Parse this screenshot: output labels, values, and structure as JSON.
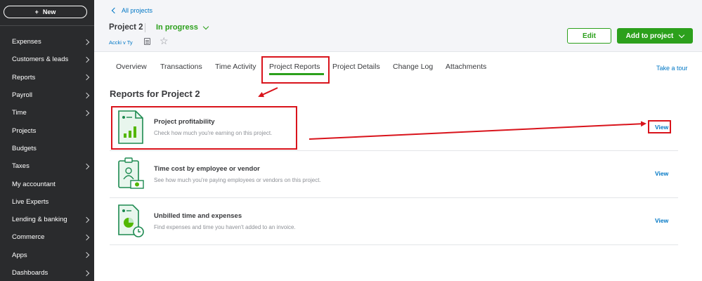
{
  "sidebar": {
    "new_label": "New",
    "items": [
      {
        "label": "Expenses",
        "chevron": true
      },
      {
        "label": "Customers & leads",
        "chevron": true
      },
      {
        "label": "Reports",
        "chevron": true
      },
      {
        "label": "Payroll",
        "chevron": true
      },
      {
        "label": "Time",
        "chevron": true
      },
      {
        "label": "Projects",
        "chevron": false
      },
      {
        "label": "Budgets",
        "chevron": false
      },
      {
        "label": "Taxes",
        "chevron": true
      },
      {
        "label": "My accountant",
        "chevron": false
      },
      {
        "label": "Live Experts",
        "chevron": false
      },
      {
        "label": "Lending & banking",
        "chevron": true
      },
      {
        "label": "Commerce",
        "chevron": true
      },
      {
        "label": "Apps",
        "chevron": true
      },
      {
        "label": "Dashboards",
        "chevron": true
      }
    ]
  },
  "header": {
    "back_label": "All projects",
    "project_name": "Project 2",
    "status": "In progress",
    "customer": "Accki v Ty",
    "edit_label": "Edit",
    "add_label": "Add to project"
  },
  "tabs": {
    "items": [
      "Overview",
      "Transactions",
      "Time Activity",
      "Project Reports",
      "Project Details",
      "Change Log",
      "Attachments"
    ],
    "active": "Project Reports",
    "tour_label": "Take a tour"
  },
  "reports": {
    "section_title": "Reports for Project 2",
    "items": [
      {
        "title": "Project profitability",
        "description": "Check how much you're earning on this project.",
        "view_label": "View"
      },
      {
        "title": "Time cost by employee or vendor",
        "description": "See how much you're paying employees or vendors on this project.",
        "view_label": "View"
      },
      {
        "title": "Unbilled time and expenses",
        "description": "Find expenses and time you haven't added to an invoice.",
        "view_label": "View"
      }
    ]
  },
  "colors": {
    "sidebar_bg": "#2a2b2d",
    "brand_green": "#2ca01c",
    "link_blue": "#0077c5",
    "annotation_red": "#d9141c"
  }
}
